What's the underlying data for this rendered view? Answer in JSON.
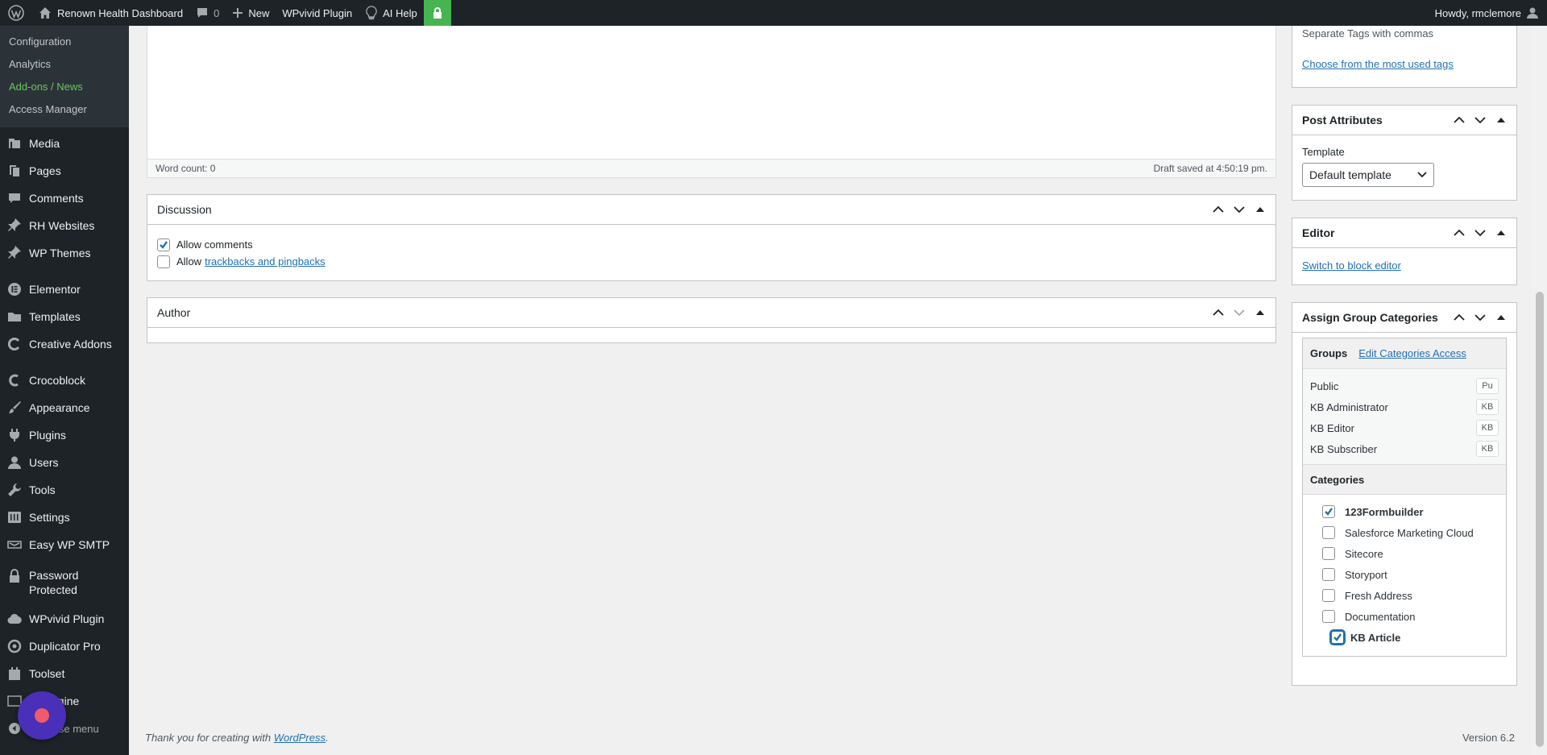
{
  "adminbar": {
    "site_name": "Renown Health Dashboard",
    "comments_count": "0",
    "new_label": "New",
    "wpvivid_label": "WPvivid Plugin",
    "ai_help_label": "AI Help",
    "howdy": "Howdy, rmclemore"
  },
  "sidebar": {
    "submenu": [
      "Configuration",
      "Analytics",
      "Add-ons / News",
      "Access Manager"
    ],
    "menu": [
      {
        "label": "Media",
        "icon": "media-icon"
      },
      {
        "label": "Pages",
        "icon": "pages-icon"
      },
      {
        "label": "Comments",
        "icon": "comments-icon"
      },
      {
        "label": "RH Websites",
        "icon": "pin-icon"
      },
      {
        "label": "WP Themes",
        "icon": "pin-icon"
      },
      {
        "label": "Elementor",
        "icon": "elementor-icon"
      },
      {
        "label": "Templates",
        "icon": "folder-icon"
      },
      {
        "label": "Creative Addons",
        "icon": "creative-icon"
      },
      {
        "label": "Crocoblock",
        "icon": "crocoblock-icon"
      },
      {
        "label": "Appearance",
        "icon": "brush-icon"
      },
      {
        "label": "Plugins",
        "icon": "plugin-icon"
      },
      {
        "label": "Users",
        "icon": "user-icon"
      },
      {
        "label": "Tools",
        "icon": "wrench-icon"
      },
      {
        "label": "Settings",
        "icon": "settings-icon"
      },
      {
        "label": "Easy WP SMTP",
        "icon": "smtp-icon"
      },
      {
        "label": "Password Protected",
        "icon": "lock-icon"
      },
      {
        "label": "WPvivid Plugin",
        "icon": "cloud-icon"
      },
      {
        "label": "Duplicator Pro",
        "icon": "duplicator-icon"
      },
      {
        "label": "Toolset",
        "icon": "toolset-icon"
      },
      {
        "label": "JetEngine",
        "icon": "jet-icon"
      }
    ],
    "collapse_label": "Collapse menu"
  },
  "editor": {
    "word_count": "Word count: 0",
    "draft_saved": "Draft saved at 4:50:19 pm."
  },
  "discussion": {
    "title": "Discussion",
    "allow_comments": "Allow comments",
    "allow_prefix": "Allow",
    "trackbacks_link": "trackbacks and pingbacks"
  },
  "author": {
    "title": "Author"
  },
  "tags": {
    "hint": "Separate Tags with commas",
    "most_used_link": "Choose from the most used tags"
  },
  "post_attributes": {
    "title": "Post Attributes",
    "template_label": "Template",
    "template_value": "Default template"
  },
  "editor_box": {
    "title": "Editor",
    "switch_link": "Switch to block editor"
  },
  "assign_groups": {
    "title": "Assign Group Categories",
    "groups_label": "Groups",
    "edit_access_link": "Edit Categories Access",
    "groups": [
      {
        "name": "Public",
        "tag": "Pu"
      },
      {
        "name": "KB Administrator",
        "tag": "KB"
      },
      {
        "name": "KB Editor",
        "tag": "KB"
      },
      {
        "name": "KB Subscriber",
        "tag": "KB"
      }
    ],
    "categories_label": "Categories",
    "categories": [
      {
        "name": "123Formbuilder",
        "checked": true
      },
      {
        "name": "Salesforce Marketing Cloud",
        "checked": false
      },
      {
        "name": "Sitecore",
        "checked": false
      },
      {
        "name": "Storyport",
        "checked": false
      },
      {
        "name": "Fresh Address",
        "checked": false
      },
      {
        "name": "Documentation",
        "checked": false
      },
      {
        "name": "KB Article",
        "checked": true
      }
    ]
  },
  "footer": {
    "thanks_prefix": "Thank you for creating with",
    "wordpress_link": "WordPress",
    "thanks_suffix": ".",
    "version": "Version 6.2"
  },
  "colors": {
    "admin_dark": "#1d2327",
    "link_blue": "#2271b1",
    "green_accent": "#65c85d",
    "lock_green": "#46b450"
  }
}
